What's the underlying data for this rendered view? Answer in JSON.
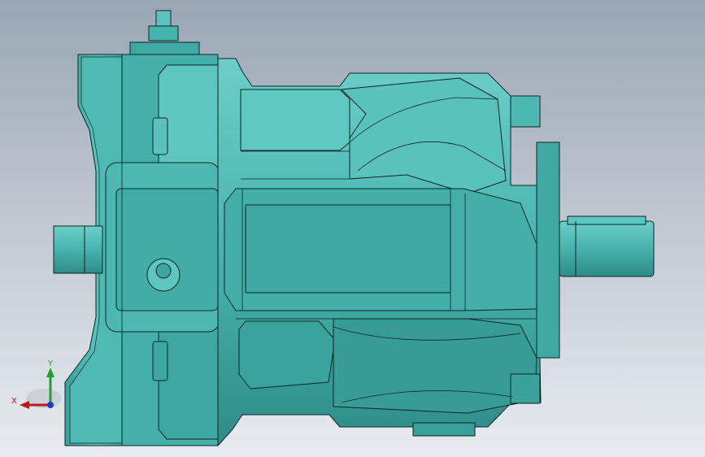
{
  "viewport": {
    "background_top": "#9aa6b4",
    "background_bottom": "#e8ecf0"
  },
  "model": {
    "name": "hydraulic-axial-piston-pump",
    "body_color": "#47b3ad",
    "highlight_color": "#6ccfc8",
    "shadow_color": "#2e8c86",
    "edge_color": "#0c2626"
  },
  "triad": {
    "x_label": "X",
    "y_label": "Y",
    "x_color": "#c0141c",
    "y_color": "#22a02a",
    "z_color": "#1e3cc8"
  }
}
